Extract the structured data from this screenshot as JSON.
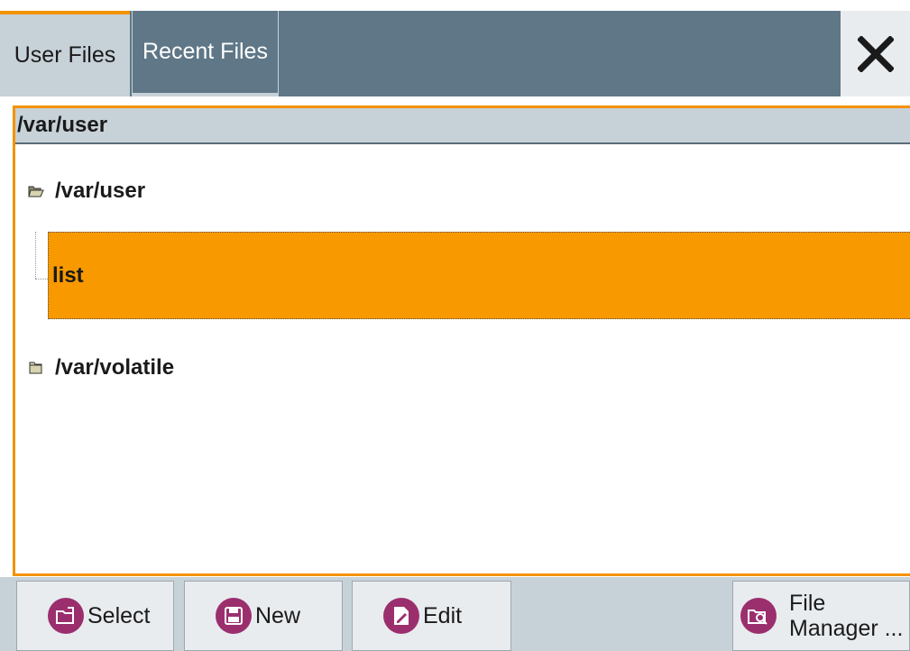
{
  "tabs": [
    {
      "label": "User Files",
      "active": true
    },
    {
      "label": "Recent Files",
      "active": false
    }
  ],
  "close": {
    "icon": "close-icon"
  },
  "panel": {
    "path": "/var/user",
    "tree": {
      "root_label": "/var/user",
      "selected_item": "list",
      "sibling_label": "/var/volatile"
    }
  },
  "buttons": {
    "select": "Select",
    "new": "New",
    "edit": "Edit",
    "file_manager_line1": "File",
    "file_manager_line2": "Manager ..."
  },
  "colors": {
    "accent": "#f39200",
    "selection": "#f89900",
    "tab_bar": "#5f7786",
    "panel_header": "#c7d1d8",
    "button_icon": "#9b2f6e"
  }
}
